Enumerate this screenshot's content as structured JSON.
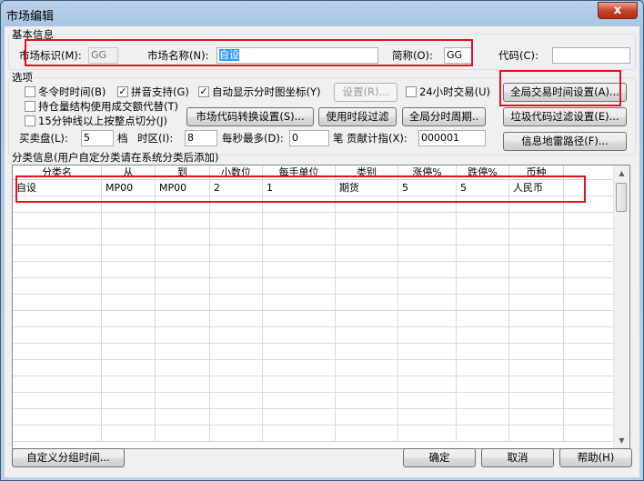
{
  "window": {
    "title": "市场编辑",
    "close_glyph": "x"
  },
  "basic": {
    "group_title": "基本信息",
    "market_id_label": "市场标识(M):",
    "market_id_value": "GG",
    "market_name_label": "市场名称(N):",
    "market_name_value": "自设",
    "short_name_label": "简称(O):",
    "short_name_value": "GG",
    "code_label": "代码(C):",
    "code_value": ""
  },
  "options": {
    "group_title": "选项",
    "dst_label": "冬令时时间(B)",
    "dst_checked": false,
    "pinyin_label": "拼音支持(G)",
    "pinyin_checked": true,
    "auto_axis_label": "自动显示分时图坐标(Y)",
    "auto_axis_checked": true,
    "settings_button": "设置(R)...",
    "h24_label": "24小时交易(U)",
    "h24_checked": false,
    "global_time_button": "全局交易时间设置(A)...",
    "position_label": "持仓量结构使用成交额代替(T)",
    "position_checked": false,
    "min15_label": "15分钟线以上按整点切分(J)",
    "min15_checked": false,
    "code_convert_button": "市场代码转换设置(S)...",
    "use_time_filter_button": "使用时段过滤",
    "global_period_button": "全局分时周期..",
    "junk_filter_button": "垃圾代码过滤设置(E)...",
    "depth_label": "买卖盘(L):",
    "depth_value": "5",
    "depth_unit": "档",
    "tz_label": "时区(I):",
    "tz_value": "8",
    "per_sec_label": "每秒最多(D):",
    "per_sec_value": "0",
    "per_sec_unit": "笔",
    "contrib_label": "贡献计指(X):",
    "contrib_value": "000001",
    "info_mine_button": "信息地雷路径(F)..."
  },
  "category": {
    "group_title": "分类信息(用户自定分类请在系统分类后添加)",
    "columns": [
      "分类名",
      "从",
      "到",
      "小数位",
      "每手单位",
      "类别",
      "涨停%",
      "跌停%",
      "币种"
    ],
    "rows": [
      [
        "自设",
        "MP00",
        "MP00",
        "2",
        "1",
        "期货",
        "5",
        "5",
        "人民币"
      ]
    ]
  },
  "footer": {
    "custom_group_button": "自定义分组时间...",
    "ok_button": "确定",
    "cancel_button": "取消",
    "help_button": "帮助(H)"
  }
}
